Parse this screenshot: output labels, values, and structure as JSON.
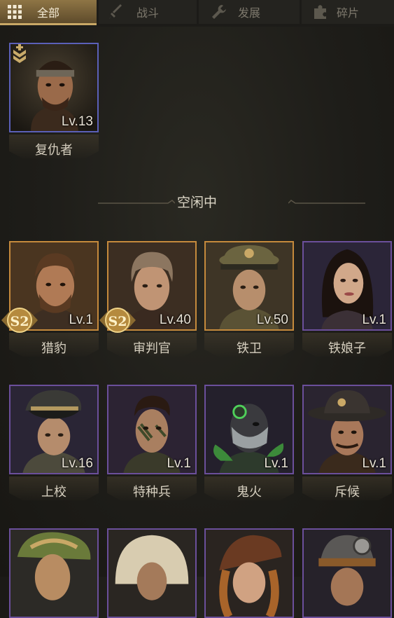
{
  "tabs": [
    {
      "label": "全部",
      "icon": "grid-icon",
      "active": true
    },
    {
      "label": "战斗",
      "icon": "sword-icon",
      "active": false
    },
    {
      "label": "发展",
      "icon": "wrench-icon",
      "active": false
    },
    {
      "label": "碎片",
      "icon": "puzzle-icon",
      "active": false
    }
  ],
  "assigned": [
    {
      "name": "复仇者",
      "level": "Lv.13",
      "rarity": "blue",
      "badge": "chevron-up-icon"
    }
  ],
  "idle_title": "空闲中",
  "idle": [
    {
      "name": "猎豹",
      "level": "Lv.1",
      "rarity": "gold",
      "badge": "S2"
    },
    {
      "name": "审判官",
      "level": "Lv.40",
      "rarity": "gold",
      "badge": "S2"
    },
    {
      "name": "铁卫",
      "level": "Lv.50",
      "rarity": "gold",
      "badge": ""
    },
    {
      "name": "铁娘子",
      "level": "Lv.1",
      "rarity": "purple",
      "badge": ""
    },
    {
      "name": "上校",
      "level": "Lv.16",
      "rarity": "purple",
      "badge": ""
    },
    {
      "name": "特种兵",
      "level": "Lv.1",
      "rarity": "purple",
      "badge": ""
    },
    {
      "name": "鬼火",
      "level": "Lv.1",
      "rarity": "purple",
      "badge": ""
    },
    {
      "name": "斥候",
      "level": "Lv.1",
      "rarity": "purple",
      "badge": ""
    },
    {
      "name": "",
      "level": "",
      "rarity": "purple",
      "badge": ""
    },
    {
      "name": "",
      "level": "",
      "rarity": "purple",
      "badge": ""
    },
    {
      "name": "",
      "level": "",
      "rarity": "purple",
      "badge": ""
    },
    {
      "name": "",
      "level": "",
      "rarity": "purple",
      "badge": ""
    }
  ]
}
